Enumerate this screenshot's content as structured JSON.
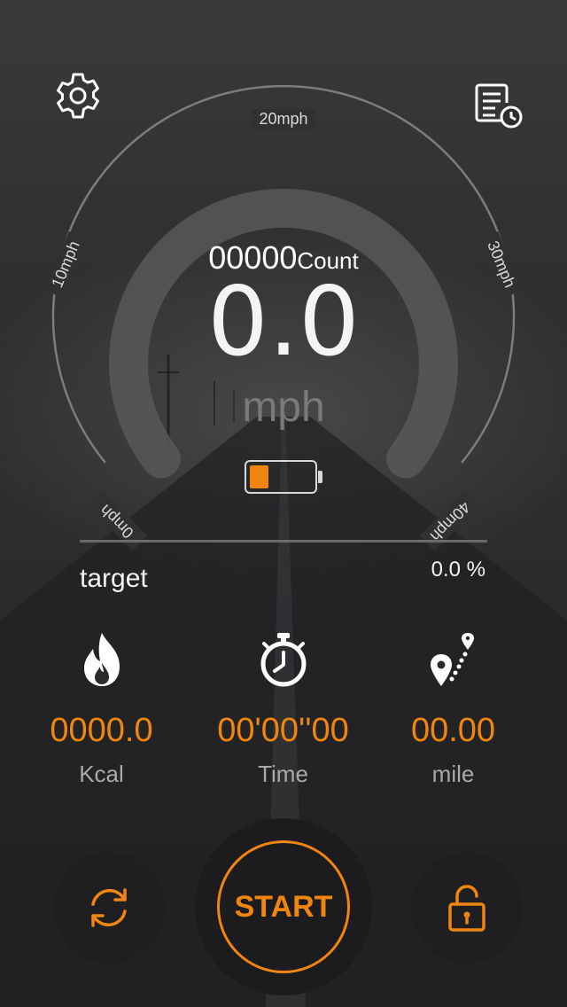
{
  "gauge": {
    "tick_labels": [
      "0mph",
      "10mph",
      "20mph",
      "30mph",
      "40mph"
    ],
    "speed_fraction": 0.0
  },
  "display": {
    "count_value": "00000",
    "count_unit": "Count",
    "speed_value": "0.0",
    "speed_unit": "mph"
  },
  "battery": {
    "level": 0.3,
    "color": "#f08510"
  },
  "target": {
    "label": "target",
    "percent_text": "0.0 %",
    "progress": 0.0
  },
  "stats": [
    {
      "icon": "flame-icon",
      "value": "0000.0",
      "label": "Kcal"
    },
    {
      "icon": "stopwatch-icon",
      "value": "00'00''00",
      "label": "Time"
    },
    {
      "icon": "route-pin-icon",
      "value": "00.00",
      "label": "mile"
    }
  ],
  "controls": {
    "start_label": "START",
    "reset_icon": "refresh-icon",
    "lock_icon": "unlock-icon"
  },
  "header": {
    "settings_icon": "gear-icon",
    "history_icon": "history-log-icon"
  },
  "colors": {
    "accent": "#f08510",
    "background": "#2b2b2d"
  }
}
